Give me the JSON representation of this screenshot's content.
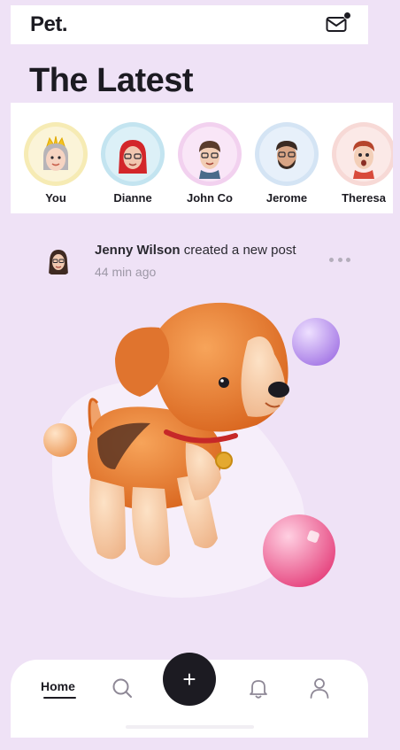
{
  "app": {
    "brand": "Pet."
  },
  "header": {
    "title": "The Latest",
    "mail_icon": "mail-icon"
  },
  "stories": [
    {
      "name": "You",
      "ring": "#f6ebb4",
      "bg": "#fbf4d8",
      "icon": "avatar-you-crown"
    },
    {
      "name": "Dianne",
      "ring": "#c3e4f0",
      "bg": "#dcf0f7",
      "icon": "avatar-dianne"
    },
    {
      "name": "John Co",
      "ring": "#f2d1ef",
      "bg": "#f9e6f7",
      "icon": "avatar-john"
    },
    {
      "name": "Jerome",
      "ring": "#d4e4f4",
      "bg": "#e7f0fa",
      "icon": "avatar-jerome"
    },
    {
      "name": "Theresa",
      "ring": "#f7d9d6",
      "bg": "#fbe9e7",
      "icon": "avatar-theresa"
    }
  ],
  "post": {
    "author": "Jenny Wilson",
    "action": "created a new post",
    "time": "44 min ago",
    "more_icon": "more-dots-icon",
    "image": "puppy-3d-illustration"
  },
  "nav": {
    "home_label": "Home",
    "add_label": "+",
    "icons": [
      "search-icon",
      "add-icon",
      "bell-icon",
      "profile-icon"
    ]
  },
  "colors": {
    "background": "#efe2f6",
    "surface": "#ffffff",
    "accent": "#1c1b22",
    "muted_text": "#9d97a6"
  }
}
